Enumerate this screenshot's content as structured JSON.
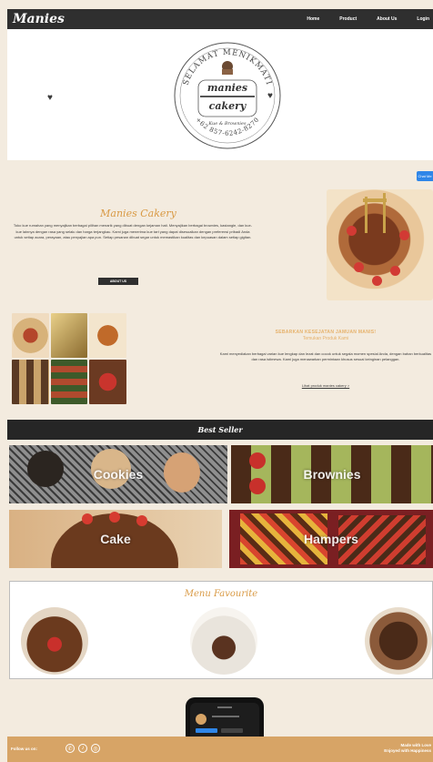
{
  "nav": {
    "logo": "Manies",
    "items": [
      "Home",
      "Product",
      "About Us",
      "Login"
    ]
  },
  "hero": {
    "seal_top_text": "SELAMAT MENIKMATI",
    "seal_name_1": "manies",
    "seal_name_2": "cakery",
    "seal_tagline": "Kue & Brownies",
    "seal_phone": "+62 857-6242-8270"
  },
  "chat_button": "Chat Me",
  "about": {
    "title": "Manies Cakery",
    "text": "Toko kue rumahan yang menyajikan berbagai pilihan menarik yang dibuat dengan kejaman hati. Menyajikan berbagai brownies, kastangle, dan kue-kue lainnya dengan rasa yang selalu dan harga terjangkau. Kami juga menerima kue tart yang dapat disesuaikan dengan preferensi pribadi Anda untuk setiap acara, perayaan, atau penyajian apa pun. Setiap pesanan dibuat segar untuk memastikan kualitas dan kepuasan dalam setiap gigitan.",
    "button": "ABOUT US"
  },
  "promo": {
    "title": "SEBARKAN KESEJATAN JAMUAN MANIS!",
    "subtitle": "Temukan Produk Kami",
    "text": "Kami menyediakan berbagai varian kue lengkap dan lezat dan cocok untuk segala momen spesial Anda, dengan bahan berkualitas dan rasa istimewa. Kami juga menawarkan permintaan khusus sesuai keinginan pelanggan.",
    "link": "Lihat produk manies cakery >"
  },
  "best_seller": {
    "title": "Best Seller",
    "tiles": [
      "Cookies",
      "Brownies",
      "Cake",
      "Hampers"
    ]
  },
  "menu_fav": {
    "title": "Menu Favourite"
  },
  "footer": {
    "follow": "Follow us on:",
    "right_1": "Made with Love",
    "right_2": "Enjoyed with Happiness"
  },
  "colors": {
    "accent": "#d99a45",
    "dark": "#2f2f2f",
    "footer": "#d7a466",
    "background": "#f3ebdf"
  }
}
